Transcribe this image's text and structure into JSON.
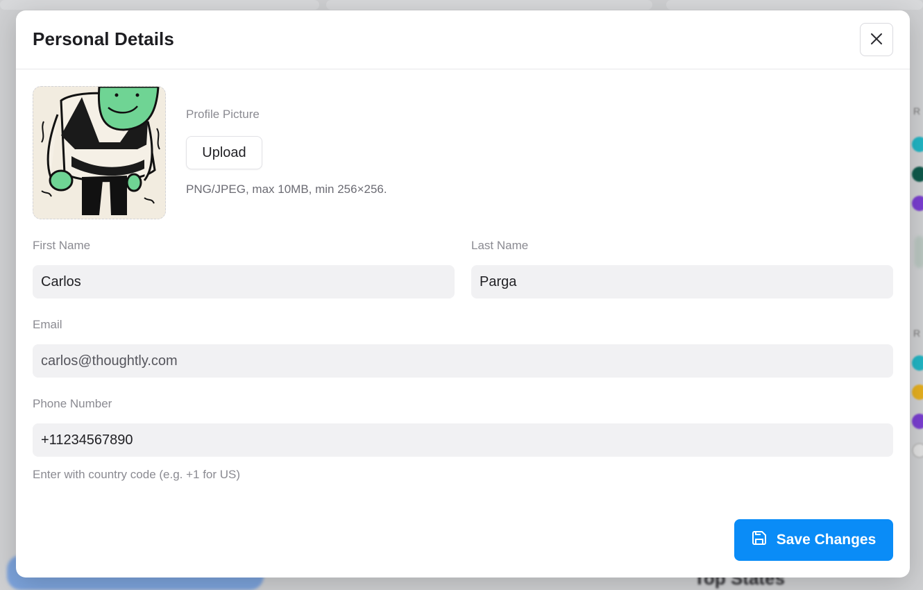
{
  "modal": {
    "title": "Personal Details",
    "close_icon": "close-icon"
  },
  "profile_picture": {
    "label": "Profile Picture",
    "upload_label": "Upload",
    "hint": "PNG/JPEG, max 10MB, min 256×256."
  },
  "fields": {
    "first_name": {
      "label": "First Name",
      "value": "Carlos"
    },
    "last_name": {
      "label": "Last Name",
      "value": "Parga"
    },
    "email": {
      "label": "Email",
      "value": "carlos@thoughtly.com"
    },
    "phone": {
      "label": "Phone Number",
      "value": "+11234567890",
      "help": "Enter with country code (e.g. +1 for US)"
    }
  },
  "actions": {
    "save_label": "Save Changes",
    "save_icon": "save-icon"
  },
  "background": {
    "section_title": "Top States"
  },
  "colors": {
    "primary": "#0a8cf7",
    "input_bg": "#f1f1f3",
    "avatar_bg": "#f2ece0",
    "avatar_green": "#6fd494"
  }
}
